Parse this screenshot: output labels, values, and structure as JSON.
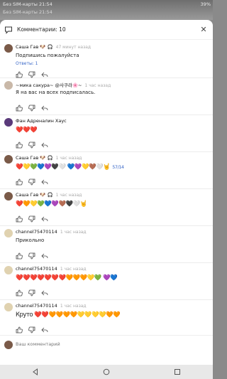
{
  "statusbar": {
    "left_text": "Без SIM-карты 21:54",
    "line2": "Без SIM-карты 21:54",
    "right_text": "39%"
  },
  "sheet": {
    "title": "Комментарии: 10",
    "close_icon": "close-icon"
  },
  "comments": [
    {
      "name": "Саша Гав 🐶 🎧",
      "time": "47 минут назад",
      "text": "Подпишись пожалуйста",
      "emoji": false,
      "replies": "Ответы: 1",
      "avatar_color": "#7a5a48"
    },
    {
      "name": "~мика сакура~ @사쿠라🌸~",
      "time": "1 час назад",
      "text": "Я на вас на всех подписалась.",
      "emoji": false,
      "replies": "",
      "avatar_color": "#c9b8a8"
    },
    {
      "name": "Фан Адреналин Хаус",
      "time": "",
      "text": "❤️❤️❤️",
      "emoji": true,
      "replies": "",
      "avatar_color": "#5a3a7a"
    },
    {
      "name": "Саша Гав 🐶 🎧",
      "time": "1 час назад",
      "text": "❤️💛💚💙💜🖤🤍 💙💜💛🤎🤍🤘",
      "extra": "57/14",
      "emoji": true,
      "replies": "",
      "avatar_color": "#7a5a48"
    },
    {
      "name": "Саша Гав 🐶 🎧",
      "time": "1 час назад",
      "text": "❤️🧡💛💚💙💜🤎🖤🤍🤘",
      "emoji": true,
      "replies": "",
      "avatar_color": "#7a5a48"
    },
    {
      "name": "channel75470114",
      "time": "1 час назад",
      "text": "Прикольно",
      "emoji": false,
      "replies": "",
      "avatar_color": "#e0d2b0"
    },
    {
      "name": "channel75470114",
      "time": "1 час назад",
      "text": "❤️❤️❤️❤️❤️❤️❤️🧡🧡🧡💛💚   💜💙",
      "emoji": true,
      "replies": "",
      "avatar_color": "#e0d2b0"
    },
    {
      "name": "channel75470114",
      "time": "1 час назад",
      "text": "Круто ❤️❤️🧡🧡🧡🧡💛💛💛💛🧡🧡",
      "emoji": true,
      "replies": "",
      "avatar_color": "#e0d2b0"
    }
  ],
  "compose": {
    "placeholder": "Ваш комментарий",
    "avatar_color": "#7a5a48"
  },
  "navbar": {
    "icons": [
      "back-triangle-icon",
      "home-circle-icon",
      "recents-square-icon"
    ]
  }
}
